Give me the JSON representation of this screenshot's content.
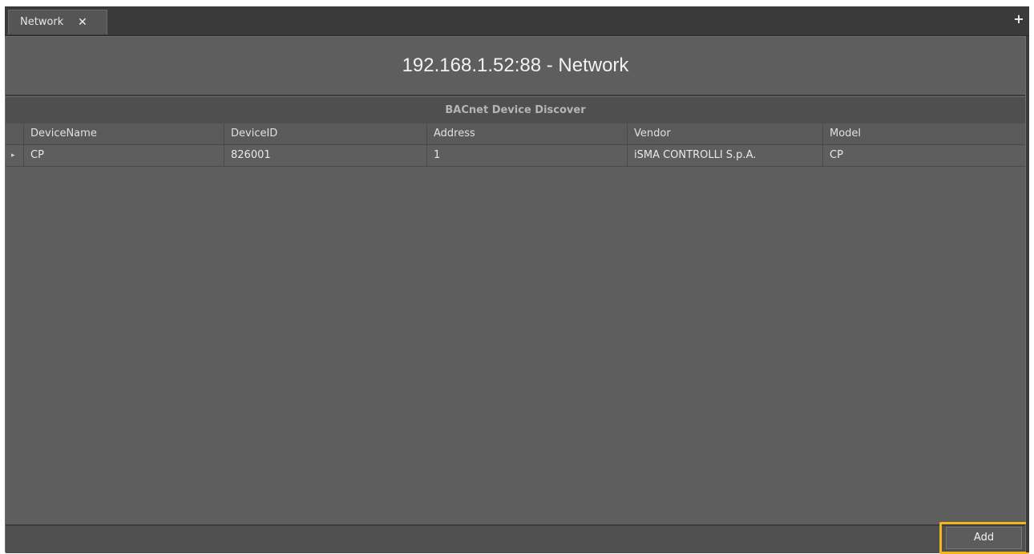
{
  "tab": {
    "label": "Network",
    "close_glyph": "✕"
  },
  "add_tab_glyph": "+",
  "page_title": "192.168.1.52:88 - Network",
  "section_title": "BACnet Device Discover",
  "table": {
    "columns": [
      "DeviceName",
      "DeviceID",
      "Address",
      "Vendor",
      "Model"
    ],
    "rows": [
      [
        "CP",
        "826001",
        "1",
        "iSMA CONTROLLI S.p.A.",
        "CP"
      ]
    ],
    "row_indicator": "▸"
  },
  "footer": {
    "add_label": "Add"
  },
  "colors": {
    "highlight": "#f2b51b",
    "panel": "#5e5e5e",
    "chrome": "#3a3a3a"
  }
}
